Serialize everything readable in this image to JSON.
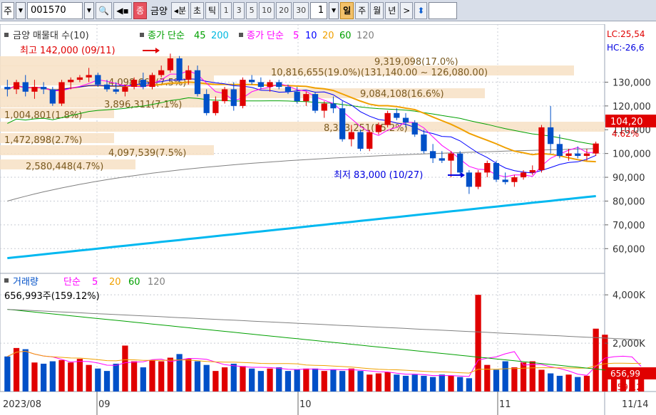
{
  "toolbar": {
    "market_label": "주",
    "code": "001570",
    "stock_name": "금양",
    "stock_tag": "종",
    "period_left": "◂분",
    "period_items": [
      "초",
      "틱"
    ],
    "numbers": [
      "1",
      "3",
      "5",
      "10",
      "20",
      "30"
    ],
    "spin_value": "1",
    "period_right": [
      "일",
      "주",
      "월",
      "년"
    ],
    "active_period": "일",
    "next": ">",
    "updown": "⬍"
  },
  "legend_top": {
    "price": "금양 매물대 수(10)",
    "ma_long_label": "종가 단순",
    "ma_long_a": "45",
    "ma_long_b": "200",
    "ma_short_label": "종가 단순",
    "ma_short_a": "5",
    "ma_short_b": "10",
    "ma_short_c": "20",
    "ma_short_d": "60",
    "ma_short_e": "120"
  },
  "legend_vol": {
    "title": "거래량",
    "ma_label": "단순",
    "a": "5",
    "b": "20",
    "c": "60",
    "d": "120",
    "current": "656,993주(159.12%)"
  },
  "annotations": {
    "high": "최고 142,000 (09/11)",
    "low": "최저 83,000 (10/27)",
    "lc": "LC:25,54",
    "hc": "HC:-26,6",
    "price_badge": "104,20",
    "pct_badge": "4.62%",
    "vol_badge": "656,99",
    "vol_pct_badge": "159,12"
  },
  "volume_profile": [
    {
      "label": "9,319,098(17.0%)"
    },
    {
      "label": "10,816,655(19.0%)(131,140.00 ~ 126,080.00)"
    },
    {
      "label": "4,098,669(7.5%)"
    },
    {
      "label": "9,084,108(16.6%)"
    },
    {
      "label": "3,896,311(7.1%)"
    },
    {
      "label": "1,004,801(1.8%)"
    },
    {
      "label": "8,333,251(15.2%)"
    },
    {
      "label": "1,472,898(2.7%)"
    },
    {
      "label": "4,097,539(7.5%)"
    },
    {
      "label": "2,580,448(4.7%)"
    }
  ],
  "chart_data": {
    "type": "candlestick",
    "price_axis": {
      "ticks": [
        "130,000",
        "120,000",
        "110,000",
        "100,000",
        "90,000",
        "80,000",
        "70,000",
        "60,000"
      ],
      "ylim": [
        52000,
        143000
      ]
    },
    "volume_axis": {
      "ticks": [
        "4,000K",
        "2,000K"
      ],
      "ylim": [
        0,
        4300000
      ]
    },
    "x_labels": [
      "2023/08",
      "09",
      "10",
      "11",
      "11/14"
    ],
    "candles": [
      [
        128000,
        131000,
        124000,
        127000
      ],
      [
        127000,
        131000,
        125000,
        130000
      ],
      [
        130000,
        133000,
        124000,
        126000
      ],
      [
        126000,
        131000,
        123000,
        128000
      ],
      [
        128000,
        130000,
        125000,
        127000
      ],
      [
        127000,
        128000,
        120000,
        121000
      ],
      [
        121000,
        131000,
        120000,
        130000
      ],
      [
        130000,
        132000,
        127000,
        131000
      ],
      [
        131000,
        133000,
        130000,
        132000
      ],
      [
        132000,
        136000,
        130000,
        133000
      ],
      [
        133000,
        134000,
        128000,
        129000
      ],
      [
        129000,
        131000,
        126000,
        127000
      ],
      [
        127000,
        130000,
        125000,
        126000
      ],
      [
        126000,
        129000,
        124000,
        128000
      ],
      [
        128000,
        132000,
        127000,
        131000
      ],
      [
        131000,
        134000,
        127000,
        128000
      ],
      [
        128000,
        134000,
        127000,
        133000
      ],
      [
        133000,
        137000,
        132000,
        135000
      ],
      [
        135000,
        142000,
        134000,
        140000
      ],
      [
        140000,
        141000,
        130000,
        131000
      ],
      [
        131000,
        137000,
        129000,
        135000
      ],
      [
        135000,
        137000,
        124000,
        125000
      ],
      [
        125000,
        127000,
        116000,
        117000
      ],
      [
        117000,
        124000,
        116000,
        122000
      ],
      [
        122000,
        128000,
        121000,
        127000
      ],
      [
        127000,
        130000,
        118000,
        120000
      ],
      [
        120000,
        132000,
        119000,
        131000
      ],
      [
        131000,
        133000,
        129000,
        130000
      ],
      [
        130000,
        132000,
        127000,
        128000
      ],
      [
        128000,
        131000,
        126000,
        130000
      ],
      [
        130000,
        131000,
        127000,
        128000
      ],
      [
        128000,
        129000,
        125000,
        126000
      ],
      [
        126000,
        128000,
        121000,
        122000
      ],
      [
        122000,
        126000,
        120000,
        125000
      ],
      [
        125000,
        126000,
        117000,
        118000
      ],
      [
        118000,
        122000,
        115000,
        121000
      ],
      [
        121000,
        124000,
        117000,
        119000
      ],
      [
        119000,
        122000,
        105000,
        106000
      ],
      [
        106000,
        112000,
        103000,
        109000
      ],
      [
        109000,
        110000,
        101000,
        102000
      ],
      [
        102000,
        110000,
        101000,
        109000
      ],
      [
        109000,
        113000,
        108000,
        112000
      ],
      [
        112000,
        118000,
        111000,
        117000
      ],
      [
        117000,
        119000,
        114000,
        115000
      ],
      [
        115000,
        117000,
        111000,
        113000
      ],
      [
        113000,
        114000,
        107000,
        108000
      ],
      [
        108000,
        110000,
        100000,
        101000
      ],
      [
        101000,
        104000,
        96000,
        98000
      ],
      [
        98000,
        101000,
        96000,
        97000
      ],
      [
        97000,
        101000,
        90000,
        100000
      ],
      [
        100000,
        101000,
        91000,
        92000
      ],
      [
        92000,
        93000,
        83000,
        86000
      ],
      [
        86000,
        93000,
        85000,
        92000
      ],
      [
        92000,
        97000,
        90000,
        96000
      ],
      [
        96000,
        97000,
        88000,
        89000
      ],
      [
        89000,
        92000,
        87000,
        88000
      ],
      [
        88000,
        91000,
        86000,
        90000
      ],
      [
        90000,
        93000,
        89000,
        92000
      ],
      [
        92000,
        95000,
        91000,
        93000
      ],
      [
        93000,
        112000,
        92000,
        111000
      ],
      [
        111000,
        120000,
        100000,
        104000
      ],
      [
        104000,
        108000,
        98000,
        99000
      ],
      [
        99000,
        102000,
        97000,
        100000
      ],
      [
        100000,
        103000,
        98000,
        99000
      ],
      [
        99000,
        102000,
        97000,
        100000
      ],
      [
        100000,
        105000,
        99000,
        104200
      ]
    ],
    "volumes": [
      1450000,
      1800000,
      1750000,
      1200000,
      1150000,
      1250000,
      1300000,
      1200000,
      1350000,
      1100000,
      950000,
      850000,
      1150000,
      1900000,
      1250000,
      1000000,
      1300000,
      1250000,
      1400000,
      1550000,
      1350000,
      1250000,
      1100000,
      850000,
      1000000,
      1150000,
      1050000,
      950000,
      850000,
      950000,
      1000000,
      850000,
      900000,
      950000,
      950000,
      850000,
      900000,
      850000,
      950000,
      850000,
      700000,
      750000,
      800000,
      700000,
      650000,
      700000,
      650000,
      600000,
      700000,
      650000,
      600000,
      550000,
      4000000,
      1100000,
      900000,
      1250000,
      1000000,
      1200000,
      1250000,
      900000,
      750000,
      650000,
      700000,
      600000,
      650000,
      2600000,
      2350000,
      1000000,
      700000,
      500000,
      656993
    ],
    "series": [
      {
        "name": "5",
        "color": "#ff00ff"
      },
      {
        "name": "10",
        "color": "#0000ff"
      },
      {
        "name": "20",
        "color": "#f0a000"
      },
      {
        "name": "60",
        "color": "#00a000"
      },
      {
        "name": "120",
        "color": "#808080"
      }
    ]
  }
}
